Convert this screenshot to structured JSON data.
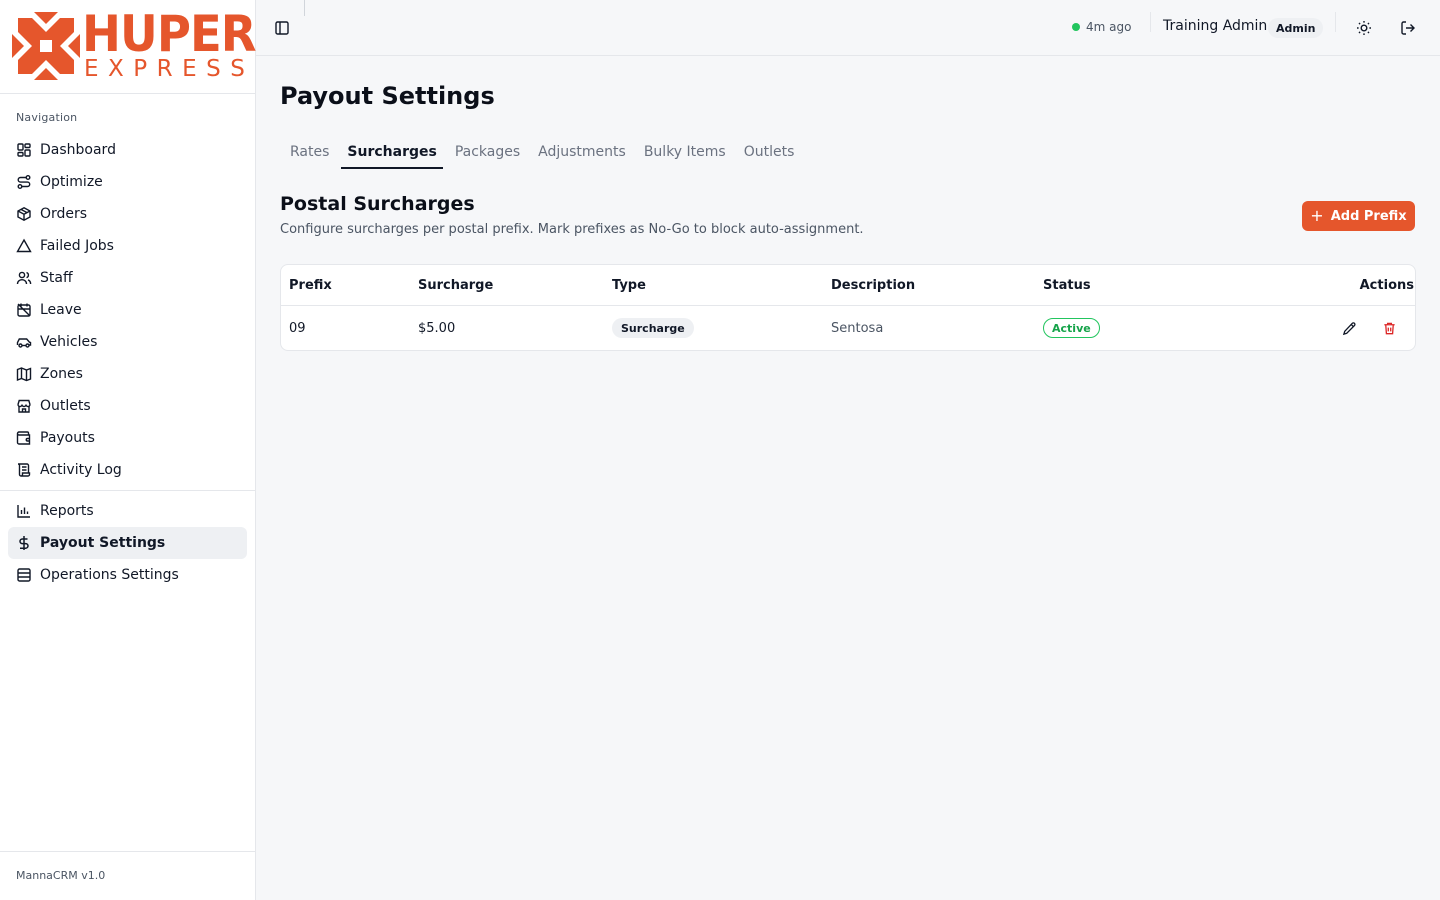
{
  "brand": {
    "logo_word": "HUPER",
    "logo_sub": "EXPRESS",
    "accent": "#e5562c"
  },
  "sidebar": {
    "heading": "Navigation",
    "items": [
      {
        "label": "Dashboard",
        "icon": "dashboard-icon"
      },
      {
        "label": "Optimize",
        "icon": "route-icon"
      },
      {
        "label": "Orders",
        "icon": "package-icon"
      },
      {
        "label": "Failed Jobs",
        "icon": "warning-triangle-icon"
      },
      {
        "label": "Staff",
        "icon": "users-icon"
      },
      {
        "label": "Leave",
        "icon": "calendar-off-icon"
      },
      {
        "label": "Vehicles",
        "icon": "car-icon"
      },
      {
        "label": "Zones",
        "icon": "map-icon"
      },
      {
        "label": "Outlets",
        "icon": "store-icon"
      },
      {
        "label": "Payouts",
        "icon": "wallet-icon"
      },
      {
        "label": "Activity Log",
        "icon": "scroll-icon"
      }
    ],
    "settings_items": [
      {
        "label": "Reports",
        "icon": "bar-chart-icon"
      },
      {
        "label": "Payout Settings",
        "icon": "dollar-icon",
        "active": true
      },
      {
        "label": "Operations Settings",
        "icon": "building-icon"
      }
    ],
    "footer": "MannaCRM v1.0"
  },
  "topbar": {
    "sync_status": "4m ago",
    "sync_color": "#22c55e",
    "user_name": "Training Admin",
    "role": "Admin"
  },
  "page": {
    "title": "Payout Settings",
    "tabs": [
      {
        "label": "Rates"
      },
      {
        "label": "Surcharges",
        "active": true
      },
      {
        "label": "Packages"
      },
      {
        "label": "Adjustments"
      },
      {
        "label": "Bulky Items"
      },
      {
        "label": "Outlets"
      }
    ],
    "section_title": "Postal Surcharges",
    "section_desc": "Configure surcharges per postal prefix. Mark prefixes as No-Go to block auto-assignment.",
    "add_button": "Add Prefix"
  },
  "table": {
    "columns": [
      "Prefix",
      "Surcharge",
      "Type",
      "Description",
      "Status",
      "Actions"
    ],
    "rows": [
      {
        "prefix": "09",
        "surcharge": "$5.00",
        "type": "Surcharge",
        "description": "Sentosa",
        "status": "Active"
      }
    ]
  }
}
